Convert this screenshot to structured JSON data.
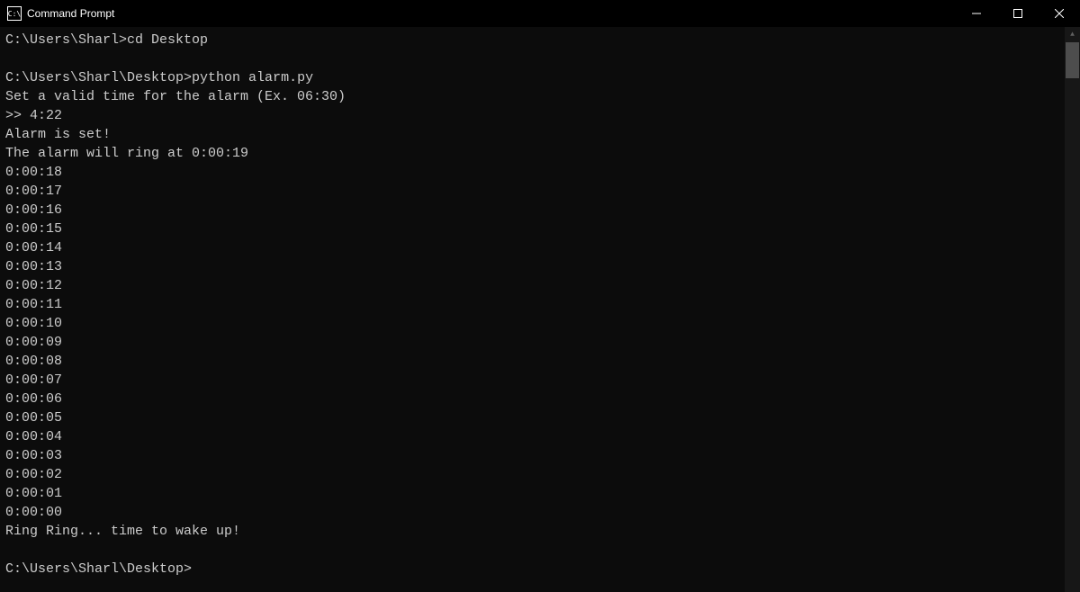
{
  "window": {
    "title": "Command Prompt",
    "icon_text": "C:\\"
  },
  "terminal": {
    "lines": [
      {
        "prompt": "C:\\Users\\Sharl>",
        "command": "cd Desktop"
      },
      {
        "blank": true
      },
      {
        "prompt": "C:\\Users\\Sharl\\Desktop>",
        "command": "python alarm.py"
      },
      {
        "text": "Set a valid time for the alarm (Ex. 06:30)"
      },
      {
        "text": ">> 4:22"
      },
      {
        "text": "Alarm is set!"
      },
      {
        "text": "The alarm will ring at 0:00:19"
      },
      {
        "text": "0:00:18"
      },
      {
        "text": "0:00:17"
      },
      {
        "text": "0:00:16"
      },
      {
        "text": "0:00:15"
      },
      {
        "text": "0:00:14"
      },
      {
        "text": "0:00:13"
      },
      {
        "text": "0:00:12"
      },
      {
        "text": "0:00:11"
      },
      {
        "text": "0:00:10"
      },
      {
        "text": "0:00:09"
      },
      {
        "text": "0:00:08"
      },
      {
        "text": "0:00:07"
      },
      {
        "text": "0:00:06"
      },
      {
        "text": "0:00:05"
      },
      {
        "text": "0:00:04"
      },
      {
        "text": "0:00:03"
      },
      {
        "text": "0:00:02"
      },
      {
        "text": "0:00:01"
      },
      {
        "text": "0:00:00"
      },
      {
        "text": "Ring Ring... time to wake up!"
      },
      {
        "blank": true
      },
      {
        "prompt": "C:\\Users\\Sharl\\Desktop>",
        "command": ""
      }
    ]
  }
}
